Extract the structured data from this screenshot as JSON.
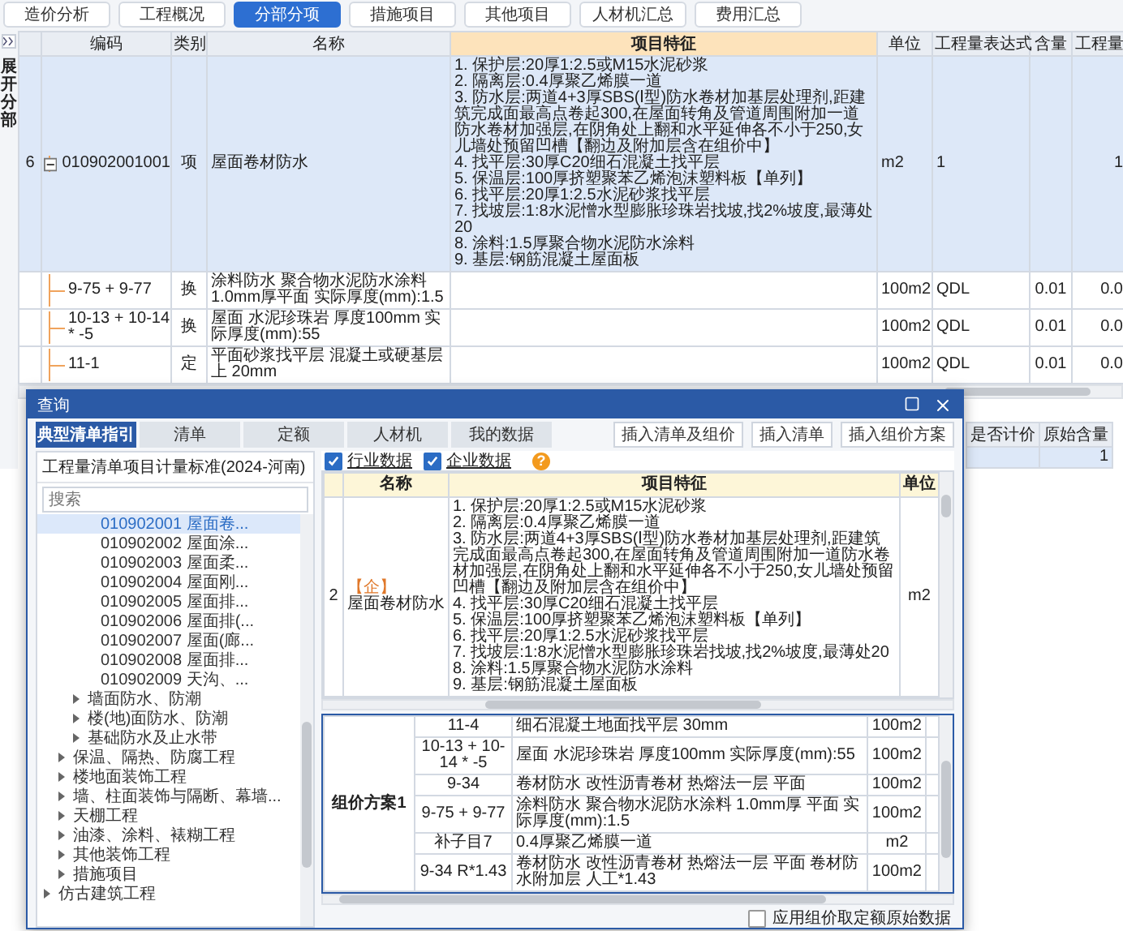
{
  "top_tabs": [
    {
      "label": "造价分析",
      "selected": false
    },
    {
      "label": "工程概况",
      "selected": false
    },
    {
      "label": "分部分项",
      "selected": true
    },
    {
      "label": "措施项目",
      "selected": false
    },
    {
      "label": "其他项目",
      "selected": false
    },
    {
      "label": "人材机汇总",
      "selected": false
    },
    {
      "label": "费用汇总",
      "selected": false
    }
  ],
  "side_panel": {
    "label": "展开分部"
  },
  "table": {
    "columns": [
      {
        "label": "编码",
        "selected": false
      },
      {
        "label": "类别",
        "selected": false
      },
      {
        "label": "名称",
        "selected": false
      },
      {
        "label": "项目特征",
        "selected": true
      },
      {
        "label": "单位",
        "selected": false
      },
      {
        "label": "工程量表达式",
        "selected": false
      },
      {
        "label": "含量",
        "selected": false
      },
      {
        "label": "工程量",
        "selected": false
      }
    ],
    "rows": [
      {
        "number": "6",
        "code": "010902001001",
        "type": "项",
        "name": "屋面卷材防水",
        "features": [
          "1. 保护层:20厚1:2.5或M15水泥砂浆",
          "2. 隔离层:0.4厚聚乙烯膜一道",
          "3. 防水层:两道4+3厚SBS(Ⅰ型)防水卷材加基层处理剂,距建筑完成面最高点卷起300,在屋面转角及管道周围附加一道防水卷材加强层,在阴角处上翻和水平延伸各不小于250,女儿墙处预留凹槽【翻边及附加层含在组价中】",
          "4. 找平层:30厚C20细石混凝土找平层",
          "5. 保温层:100厚挤塑聚苯乙烯泡沫塑料板【单列】",
          "6. 找平层:20厚1:2.5水泥砂浆找平层",
          "7. 找坡层:1:8水泥憎水型膨胀珍珠岩找坡,找2%坡度,最薄处20",
          "8. 涂料:1.5厚聚合物水泥防水涂料",
          "9. 基层:钢筋混凝土屋面板"
        ],
        "unit": "m2",
        "expression": "1",
        "quantity": "1",
        "selected": true,
        "expanded": true,
        "children": [
          {
            "code": "9-75 + 9-77",
            "type": "换",
            "name": "涂料防水 聚合物水泥防水涂料 1.0mm厚平面 实际厚度(mm):1.5",
            "unit": "100m2",
            "expression": "QDL",
            "content": "0.01",
            "quantity": "0.0"
          },
          {
            "code": "10-13 + 10-14 * -5",
            "type": "换",
            "name": "屋面 水泥珍珠岩 厚度100mm 实际厚度(mm):55",
            "unit": "100m2",
            "expression": "QDL",
            "content": "0.01",
            "quantity": "0.0"
          },
          {
            "code": "11-1",
            "type": "定",
            "name": "平面砂浆找平层 混凝土或硬基层上 20mm",
            "unit": "100m2",
            "expression": "QDL",
            "content": "0.01",
            "quantity": "0.0"
          }
        ]
      }
    ]
  },
  "lower_table": {
    "columns": [
      "是否计价",
      "原始含量"
    ],
    "rows": [
      {
        "original_content": "1",
        "selected": true
      }
    ]
  },
  "dialog": {
    "title": "查询",
    "tabs": [
      {
        "label": "典型清单指引",
        "selected": true
      },
      {
        "label": "清单",
        "selected": false
      },
      {
        "label": "定额",
        "selected": false
      },
      {
        "label": "人材机",
        "selected": false
      },
      {
        "label": "我的数据",
        "selected": false
      }
    ],
    "actions": [
      "插入清单及组价",
      "插入清单",
      "插入组价方案"
    ],
    "tree_title": "工程量清单项目计量标准(2024-河南)",
    "search": {
      "placeholder": "搜索"
    },
    "tree": [
      {
        "children": [
          {
            "children": [
              {
                "children": [
                  {
                    "label": "010902001 屋面卷...",
                    "selected": true
                  },
                  {
                    "label": "010902002 屋面涂...",
                    "selected": false
                  },
                  {
                    "label": "010902003 屋面柔...",
                    "selected": false
                  },
                  {
                    "label": "010902004 屋面刚...",
                    "selected": false
                  },
                  {
                    "label": "010902005 屋面排...",
                    "selected": false
                  },
                  {
                    "label": "010902006 屋面排(...",
                    "selected": false
                  },
                  {
                    "label": "010902007 屋面(廊...",
                    "selected": false
                  },
                  {
                    "label": "010902008 屋面排...",
                    "selected": false
                  },
                  {
                    "label": "010902009 天沟、...",
                    "selected": false
                  }
                ]
              },
              {
                "label": "墙面防水、防潮",
                "expanded": false
              },
              {
                "label": "楼(地)面防水、防潮",
                "expanded": false
              },
              {
                "label": "基础防水及止水带",
                "expanded": false
              }
            ]
          },
          {
            "label": "保温、隔热、防腐工程",
            "expanded": false
          },
          {
            "label": "楼地面装饰工程",
            "expanded": false
          },
          {
            "label": "墙、柱面装饰与隔断、幕墙...",
            "expanded": false
          },
          {
            "label": "天棚工程",
            "expanded": false
          },
          {
            "label": "油漆、涂料、裱糊工程",
            "expanded": false
          },
          {
            "label": "其他装饰工程",
            "expanded": false
          },
          {
            "label": "措施项目",
            "expanded": false
          }
        ]
      },
      {
        "label": "仿古建筑工程",
        "expanded": false
      }
    ],
    "filters": [
      {
        "label": "行业数据",
        "checked": true
      },
      {
        "label": "企业数据",
        "checked": true
      }
    ],
    "help": "?",
    "results": {
      "columns": [
        "名称",
        "项目特征",
        "单位"
      ],
      "rows": [
        {
          "number": "2",
          "tag": "【企】",
          "name": "屋面卷材防水",
          "features": [
            "1. 保护层:20厚1:2.5或M15水泥砂浆",
            "2. 隔离层:0.4厚聚乙烯膜一道",
            "3. 防水层:两道4+3厚SBS(Ⅰ型)防水卷材加基层处理剂,距建筑完成面最高点卷起300,在屋面转角及管道周围附加一道防水卷材加强层,在阴角处上翻和水平延伸各不小于250,女儿墙处预留凹槽【翻边及附加层含在组价中】",
            "4. 找平层:30厚C20细石混凝土找平层",
            "5. 保温层:100厚挤塑聚苯乙烯泡沫塑料板【单列】",
            "6. 找平层:20厚1:2.5水泥砂浆找平层",
            "7. 找坡层:1:8水泥憎水型膨胀珍珠岩找坡,找2%坡度,最薄处20",
            "8. 涂料:1.5厚聚合物水泥防水涂料",
            "9. 基层:钢筋混凝土屋面板"
          ],
          "unit": "m2"
        }
      ]
    },
    "plan": {
      "name": "组价方案1",
      "items": [
        {
          "code": "11-4",
          "description": "细石混凝土地面找平层 30mm",
          "unit": "100m2"
        },
        {
          "code": "10-13 + 10-14 * -5",
          "description": "屋面 水泥珍珠岩 厚度100mm 实际厚度(mm):55",
          "unit": "100m2"
        },
        {
          "code": "9-34",
          "description": "卷材防水 改性沥青卷材 热熔法一层 平面",
          "unit": "100m2"
        },
        {
          "code": "9-75 + 9-77",
          "description": "涂料防水 聚合物水泥防水涂料 1.0mm厚 平面 实际厚度(mm):1.5",
          "unit": "100m2"
        },
        {
          "code": "补子目7",
          "description": "0.4厚聚乙烯膜一道",
          "unit": "m2"
        },
        {
          "code": "9-34 R*1.43",
          "description": "卷材防水 改性沥青卷材 热熔法一层 平面 卷材防水附加层 人工*1.43",
          "unit": "100m2"
        }
      ]
    },
    "apply_option": {
      "label": "应用组价取定额原始数据",
      "checked": false
    }
  }
}
